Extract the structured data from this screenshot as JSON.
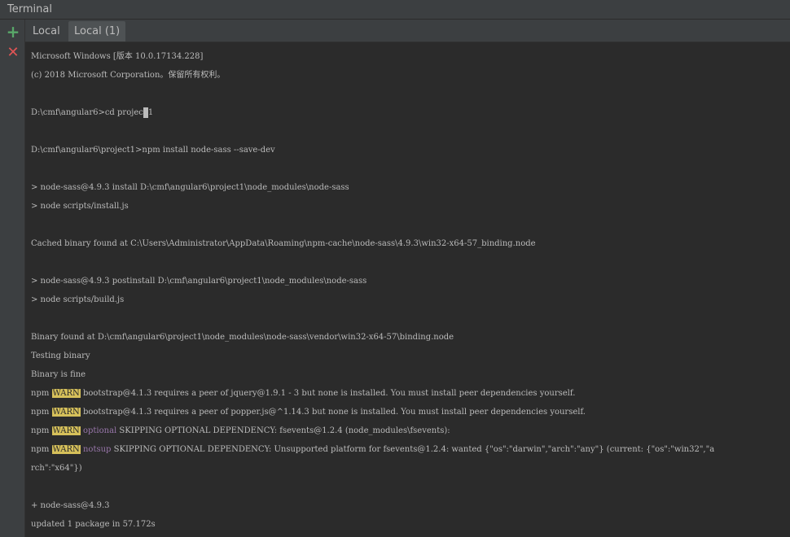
{
  "window": {
    "title": "Terminal"
  },
  "toolbar": {
    "add_label": "+",
    "close_label": "✕"
  },
  "tabs": [
    {
      "label": "Local",
      "active": false
    },
    {
      "label": "Local (1)",
      "active": true
    }
  ],
  "console": {
    "lines": [
      {
        "text": "Microsoft Windows [版本 10.0.17134.228]"
      },
      {
        "text": "(c) 2018 Microsoft Corporation。保留所有权利。"
      },
      {
        "text": ""
      },
      {
        "parts": [
          "D:\\cmf\\angular6>cd projec",
          "1"
        ]
      },
      {
        "text": ""
      },
      {
        "text": "D:\\cmf\\angular6\\project1>npm install node-sass --save-dev"
      },
      {
        "text": ""
      },
      {
        "text": "> node-sass@4.9.3 install D:\\cmf\\angular6\\project1\\node_modules\\node-sass"
      },
      {
        "text": "> node scripts/install.js"
      },
      {
        "text": ""
      },
      {
        "text": "Cached binary found at C:\\Users\\Administrator\\AppData\\Roaming\\npm-cache\\node-sass\\4.9.3\\win32-x64-57_binding.node"
      },
      {
        "text": ""
      },
      {
        "text": "> node-sass@4.9.3 postinstall D:\\cmf\\angular6\\project1\\node_modules\\node-sass"
      },
      {
        "text": "> node scripts/build.js"
      },
      {
        "text": ""
      },
      {
        "text": "Binary found at D:\\cmf\\angular6\\project1\\node_modules\\node-sass\\vendor\\win32-x64-57\\binding.node"
      },
      {
        "text": "Testing binary"
      },
      {
        "text": "Binary is fine"
      },
      {
        "npm": "npm",
        "warn": "WARN",
        "rest": " bootstrap@4.1.3 requires a peer of jquery@1.9.1 - 3 but none is installed. You must install peer dependencies yourself."
      },
      {
        "npm": "npm",
        "warn": "WARN",
        "rest": " bootstrap@4.1.3 requires a peer of popper.js@^1.14.3 but none is installed. You must install peer dependencies yourself."
      },
      {
        "npm": "npm",
        "warn": "WARN",
        "kw": "optional",
        "rest": " SKIPPING OPTIONAL DEPENDENCY: fsevents@1.2.4 (node_modules\\fsevents):"
      },
      {
        "npm": "npm",
        "warn": "WARN",
        "kw": "notsup",
        "rest": " SKIPPING OPTIONAL DEPENDENCY: Unsupported platform for fsevents@1.2.4: wanted {\"os\":\"darwin\",\"arch\":\"any\"} (current: {\"os\":\"win32\",\"a"
      },
      {
        "text": "rch\":\"x64\"})"
      },
      {
        "text": ""
      },
      {
        "text": "+ node-sass@4.9.3"
      },
      {
        "text": "updated 1 package in 57.172s"
      }
    ]
  }
}
